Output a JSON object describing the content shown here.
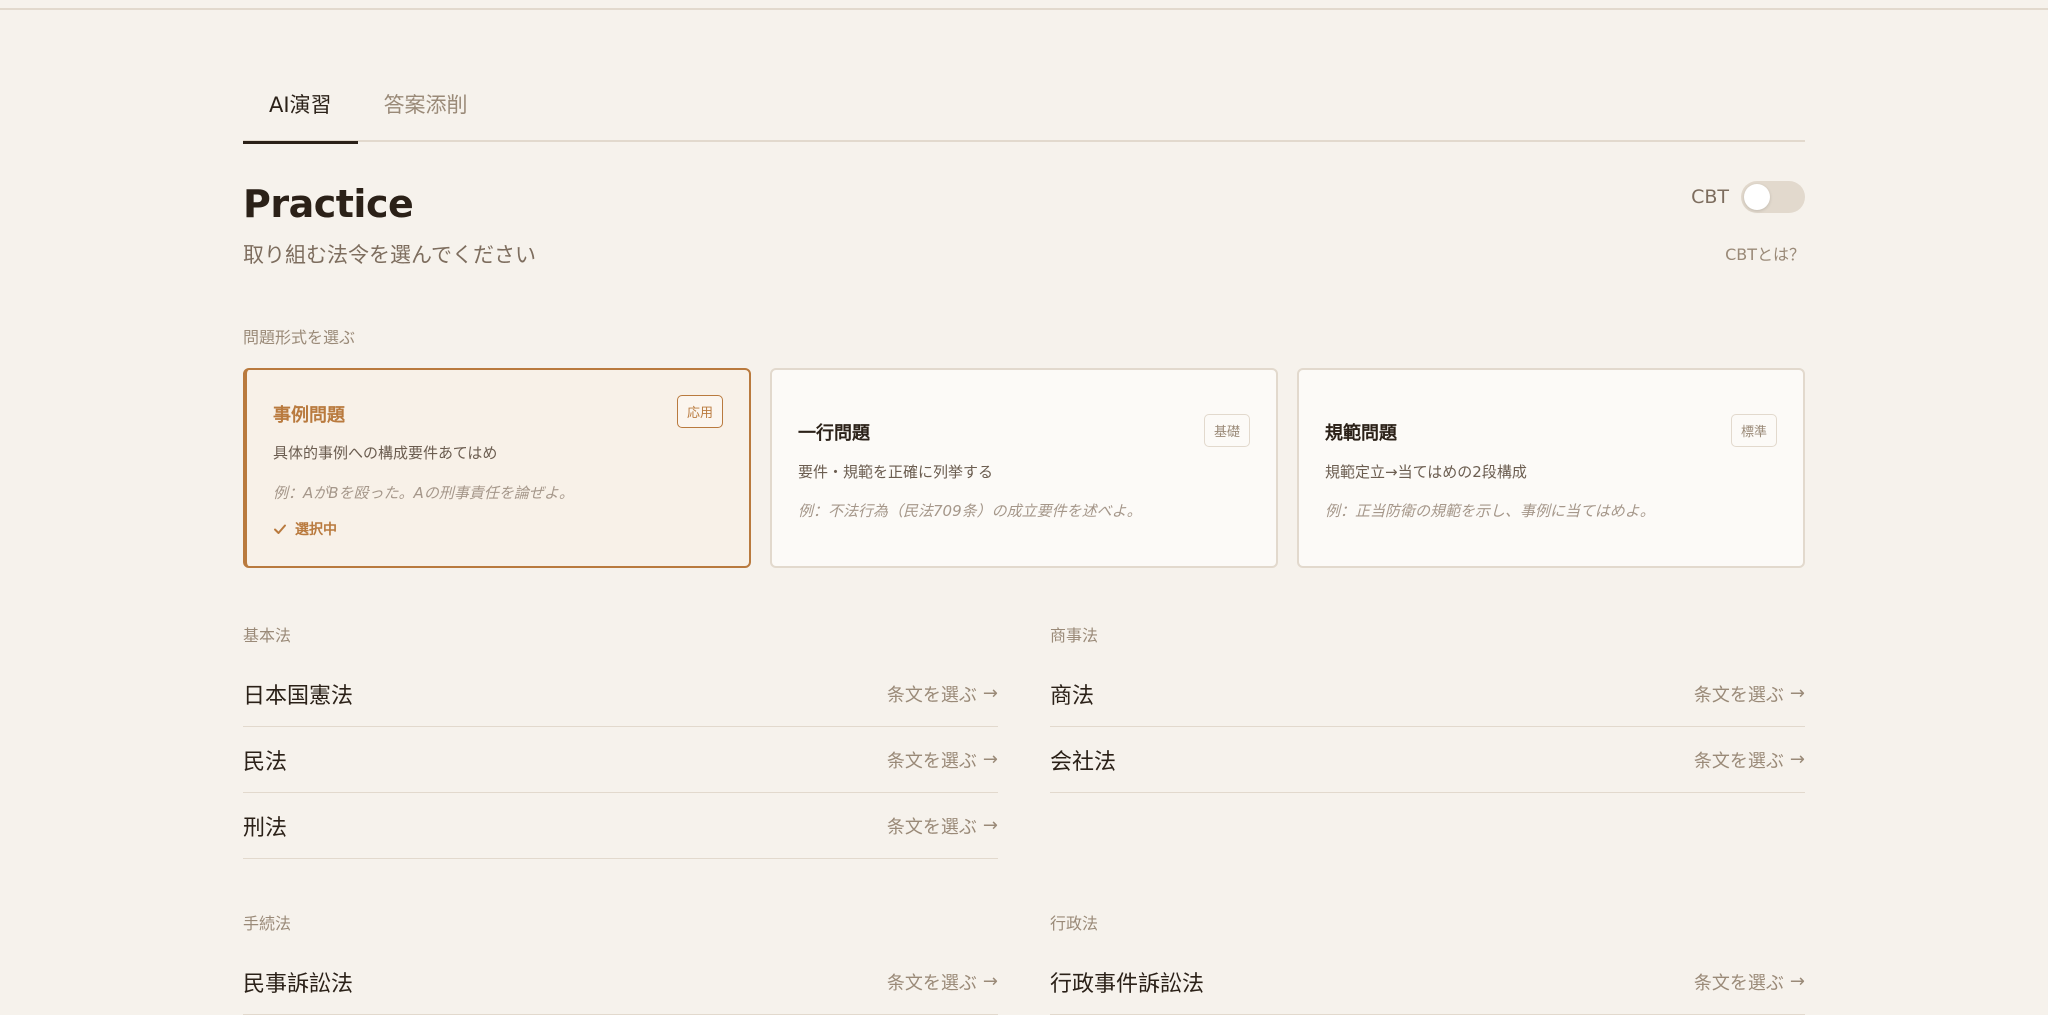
{
  "tabs": [
    {
      "label": "AI演習",
      "active": true
    },
    {
      "label": "答案添削",
      "active": false
    }
  ],
  "header": {
    "title": "Practice",
    "subtitle": "取り組む法令を選んでください",
    "cbt_label": "CBT",
    "cbt_enabled": false,
    "cbt_help": "CBTとは？"
  },
  "question_format": {
    "label": "問題形式を選ぶ",
    "cards": [
      {
        "title": "事例問題",
        "badge": "応用",
        "description": "具体的事例への構成要件あてはめ",
        "example": "例：AがBを殴った。Aの刑事責任を論ぜよ。",
        "selected": true,
        "selected_note": "選択中"
      },
      {
        "title": "一行問題",
        "badge": "基礎",
        "description": "要件・規範を正確に列挙する",
        "example": "例：不法行為（民法709条）の成立要件を述べよ。",
        "selected": false
      },
      {
        "title": "規範問題",
        "badge": "標準",
        "description": "規範定立→当てはめの2段構成",
        "example": "例：正当防衛の規範を示し、事例に当てはめよ。",
        "selected": false
      }
    ]
  },
  "law_groups": [
    {
      "label": "基本法",
      "items": [
        {
          "name": "日本国憲法",
          "action": "条文を選ぶ"
        },
        {
          "name": "民法",
          "action": "条文を選ぶ"
        },
        {
          "name": "刑法",
          "action": "条文を選ぶ"
        }
      ]
    },
    {
      "label": "商事法",
      "items": [
        {
          "name": "商法",
          "action": "条文を選ぶ"
        },
        {
          "name": "会社法",
          "action": "条文を選ぶ"
        }
      ]
    },
    {
      "label": "手続法",
      "items": [
        {
          "name": "民事訴訟法",
          "action": "条文を選ぶ"
        }
      ]
    },
    {
      "label": "行政法",
      "items": [
        {
          "name": "行政事件訴訟法",
          "action": "条文を選ぶ"
        }
      ]
    }
  ],
  "icons": {
    "arrow": "arrow-right-icon",
    "check": "check-icon"
  },
  "colors": {
    "background": "#f6f2ec",
    "accent": "#b97a3e",
    "text": "#2b2118",
    "muted": "#9a8a78",
    "border": "#e2d9cd"
  }
}
